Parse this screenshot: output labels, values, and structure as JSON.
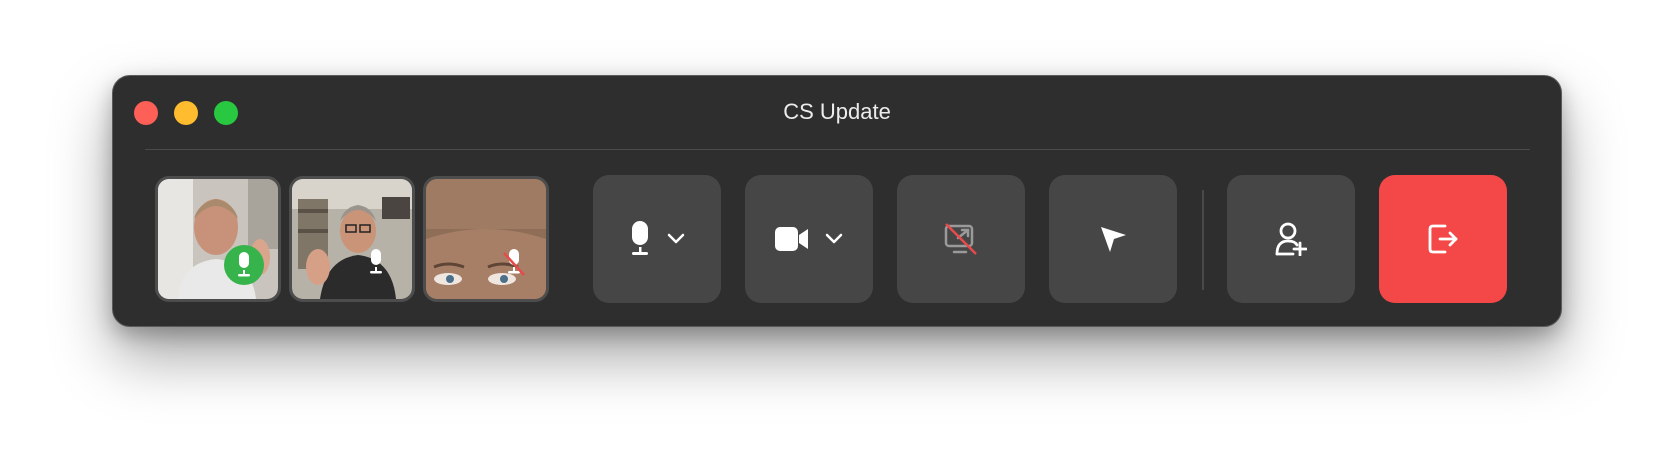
{
  "window": {
    "title": "CS Update"
  },
  "participants": [
    {
      "status": "speaking",
      "icon": "mic-icon"
    },
    {
      "status": "unmuted",
      "icon": "mic-icon"
    },
    {
      "status": "muted",
      "icon": "mic-off-icon"
    }
  ],
  "controls": {
    "microphone": {
      "icon": "mic-icon",
      "menu": "chevron-down-icon"
    },
    "camera": {
      "icon": "video-camera-icon",
      "menu": "chevron-down-icon"
    },
    "screen_share": {
      "icon": "screen-share-off-icon"
    },
    "pointer": {
      "icon": "cursor-arrow-icon"
    },
    "invite": {
      "icon": "add-person-icon"
    },
    "leave": {
      "icon": "leave-icon"
    }
  },
  "colors": {
    "window_bg": "#2e2e2e",
    "control_bg": "#464646",
    "leave_bg": "#f44848",
    "speaking_green": "#36b34a",
    "traffic_close": "#fe5f57",
    "traffic_min": "#febc2e",
    "traffic_max": "#28c840"
  }
}
